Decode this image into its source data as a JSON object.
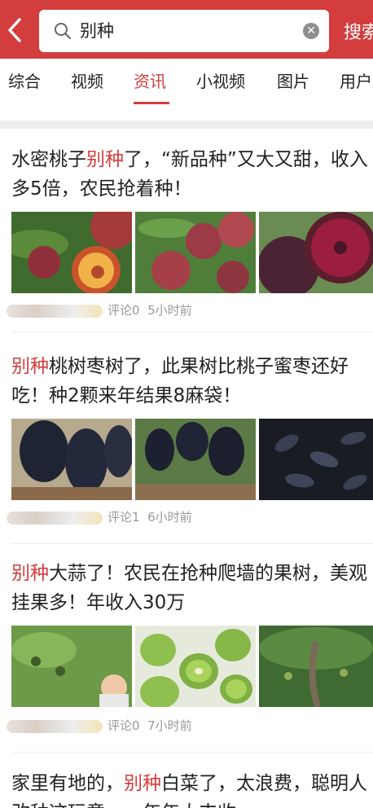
{
  "search": {
    "query": "别种",
    "button_label": "搜索"
  },
  "tabs": [
    {
      "label": "综合"
    },
    {
      "label": "视频"
    },
    {
      "label": "资讯"
    },
    {
      "label": "小视频"
    },
    {
      "label": "图片"
    },
    {
      "label": "用户"
    }
  ],
  "articles": [
    {
      "title_parts": [
        "水密桃子",
        "别种",
        "了，“新品种”又大又甜，收入多5倍，农民抢着种！"
      ],
      "comments": "评论0",
      "time": "5小时前"
    },
    {
      "title_parts": [
        "",
        "别种",
        "桃树枣树了，此果树比桃子蜜枣还好吃！种2颗来年结果8麻袋！"
      ],
      "comments": "评论1",
      "time": "6小时前"
    },
    {
      "title_parts": [
        "",
        "别种",
        "大蒜了！农民在抢种爬墙的果树，美观挂果多！年收入30万"
      ],
      "comments": "评论0",
      "time": "7小时前"
    },
    {
      "title_parts": [
        "家里有地的，",
        "别种",
        "白菜了，太浪费，聪明人改种这玩意，一年年大丰收"
      ]
    }
  ],
  "colors": {
    "accent": "#d43d3d",
    "meta": "#999999"
  }
}
